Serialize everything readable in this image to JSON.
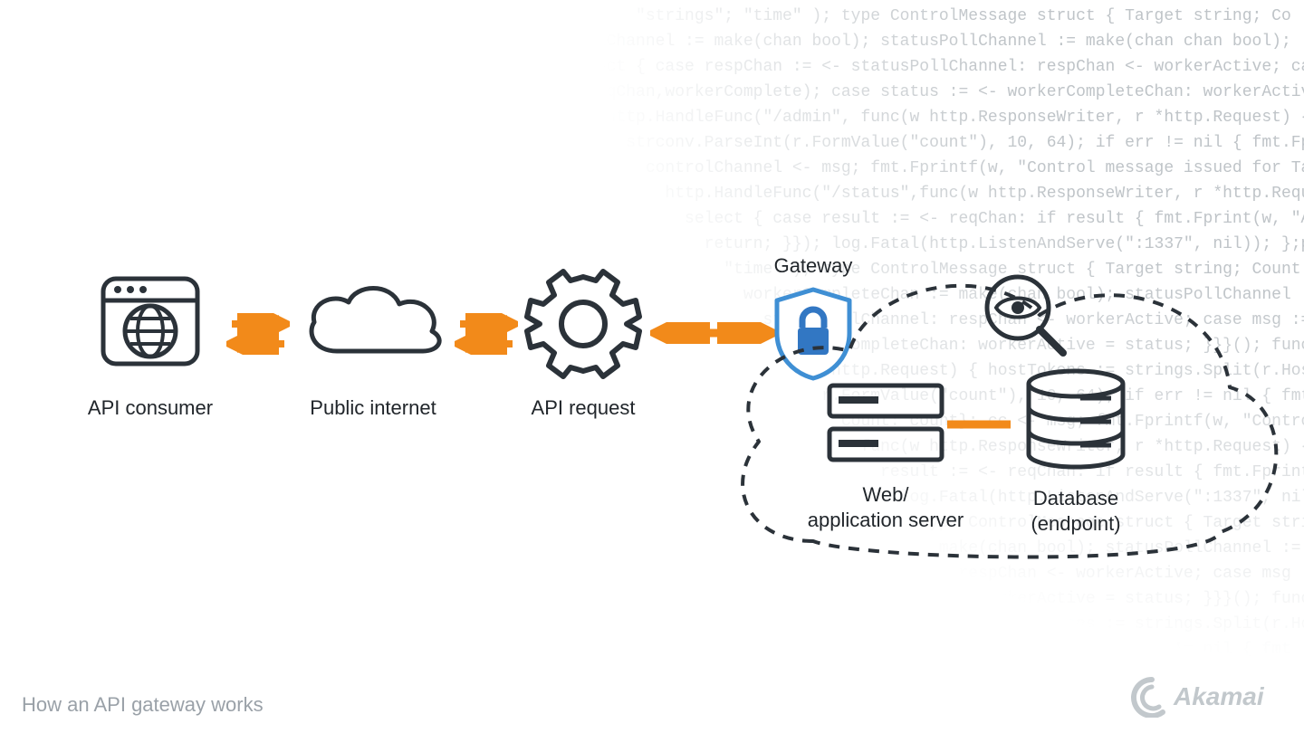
{
  "caption": "How an API gateway works",
  "brand": "Akamai",
  "nodes": {
    "consumer": "API consumer",
    "internet": "Public internet",
    "request": "API request",
    "gateway": "Gateway",
    "server": "Web/\napplication server",
    "database": "Database\n(endpoint)"
  },
  "colors": {
    "stroke": "#2b3239",
    "orange": "#f28a1a",
    "blue_stroke": "#3f8fd4",
    "blue_fill": "#3277c3",
    "brand": "#c2c8cc"
  },
  "code_bg": "               \"strings\"; \"time\" ); type ControlMessage struct { Target string; Co\n     controlChannel := make(chan bool); statusPollChannel := make(chan chan bool);\n        select { case respChan := <- statusPollChannel: respChan <- workerActive; case\n          reqChan,workerComplete); case status := <- workerCompleteChan: workerActive = status;\n            http.HandleFunc(\"/admin\", func(w http.ResponseWriter, r *http.Request) { hostTo\n              strconv.ParseInt(r.FormValue(\"count\"), 10, 64); if err != nil { fmt.Fprintf(w,\n                controlChannel <- msg; fmt.Fprintf(w, \"Control message issued for Ta\n                  http.HandleFunc(\"/status\",func(w http.ResponseWriter, r *http.Request) { reqChan\n                    select { case result := <- reqChan: if result { fmt.Fprint(w, \"ACTIVE\"\n                      return; }}); log.Fatal(http.ListenAndServe(\":1337\", nil)); };pa\n                        \"time\" ); type ControlMessage struct { Target string; Count int64; }; func ma\n                          workerCompleteChan := make(chan bool); statusPollChannel := make(chan chan bool); workerAct\n                            statusPollChannel: respChan <- workerActive; case msg := <-\n                              workerCompleteChan: workerActive = status; }}}(); func admin(\n                                r *http.Request) { hostTokens := strings.Split(r.Host,\":\"); hostTokens\n                                  r.FormValue(\"count\"), 10, 64); if err != nil { fmt.Fprintf(w,\n                                    Count: count}; cc <- msg; fmt.Fprintf(w, \"Control message issued for Ta\n                                      func(w http.ResponseWriter, r *http.Request) { reqChan\n                                        result := <- reqChan: if result { fmt.Fprint(w, \"ACTIVE\"\n                                          log.Fatal(http.ListenAndServe(\":1337\", nil)); };pa\n                                            type ControlMessage struct { Target string; Count\n                                              make(chan bool); statusPollChannel := make(chan chan bool); workerAct\n                                                respChan <- workerActive; case msg := <-\n                                                  workerActive = status; }}}(); func admin(\n                                                    hostTokens := strings.Split(r.Host\n                                                      10, 64); if err != nil { fmt\n                                                        cc <- msg; fmt.Fprintf(w,\n                                                          func(w http.ResponseWri"
}
